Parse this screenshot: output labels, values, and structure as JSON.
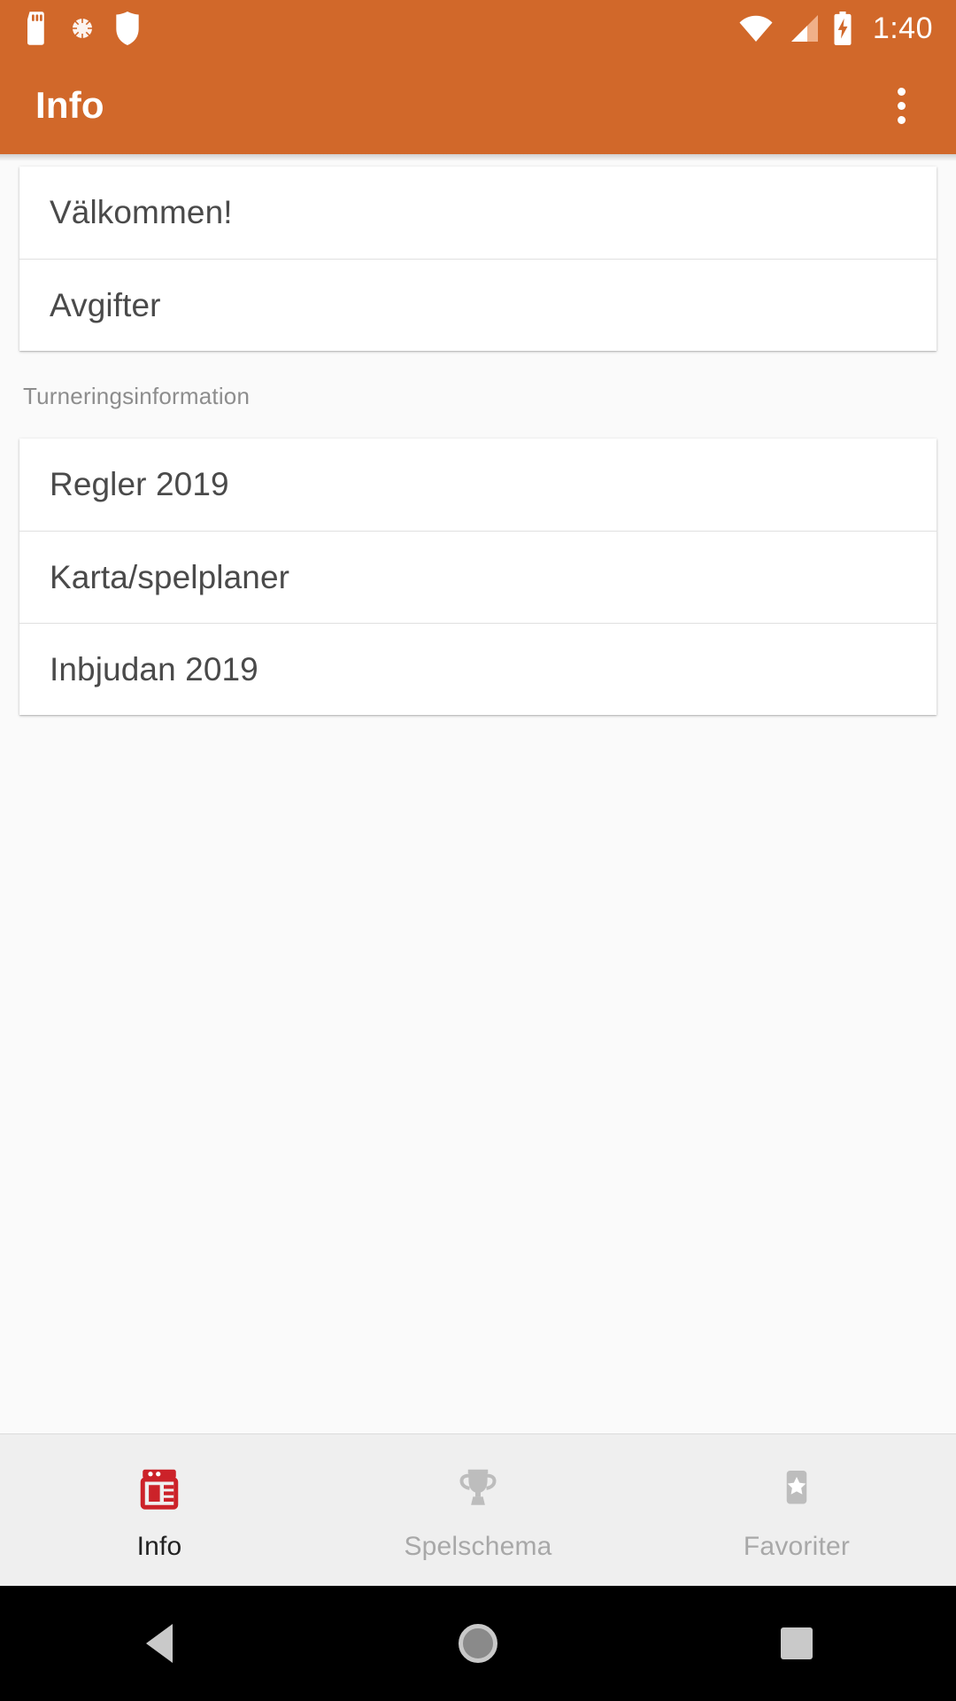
{
  "status_bar": {
    "time": "1:40",
    "left_icons": [
      "sd-card-icon",
      "sync-circle-icon",
      "shield-icon"
    ],
    "right_icons": [
      "wifi-icon",
      "cellular-signal-icon",
      "battery-charging-icon"
    ]
  },
  "app_bar": {
    "title": "Info",
    "overflow_label": "more-options",
    "background_color": "#d1682a"
  },
  "content": {
    "groups": [
      {
        "header": null,
        "items": [
          {
            "label": "Välkommen!"
          },
          {
            "label": "Avgifter"
          }
        ]
      },
      {
        "header": "Turneringsinformation",
        "items": [
          {
            "label": "Regler 2019"
          },
          {
            "label": "Karta/spelplaner"
          },
          {
            "label": "Inbjudan 2019"
          }
        ]
      }
    ]
  },
  "bottom_nav": {
    "items": [
      {
        "label": "Info",
        "icon": "article-reader-icon",
        "active": true,
        "color": "#cc2229"
      },
      {
        "label": "Spelschema",
        "icon": "trophy-icon",
        "active": false,
        "color": "#bdbdbd"
      },
      {
        "label": "Favoriter",
        "icon": "star-bookmark-icon",
        "active": false,
        "color": "#bdbdbd"
      }
    ]
  },
  "system_nav": {
    "back_label": "back",
    "home_label": "home",
    "recents_label": "recents"
  }
}
